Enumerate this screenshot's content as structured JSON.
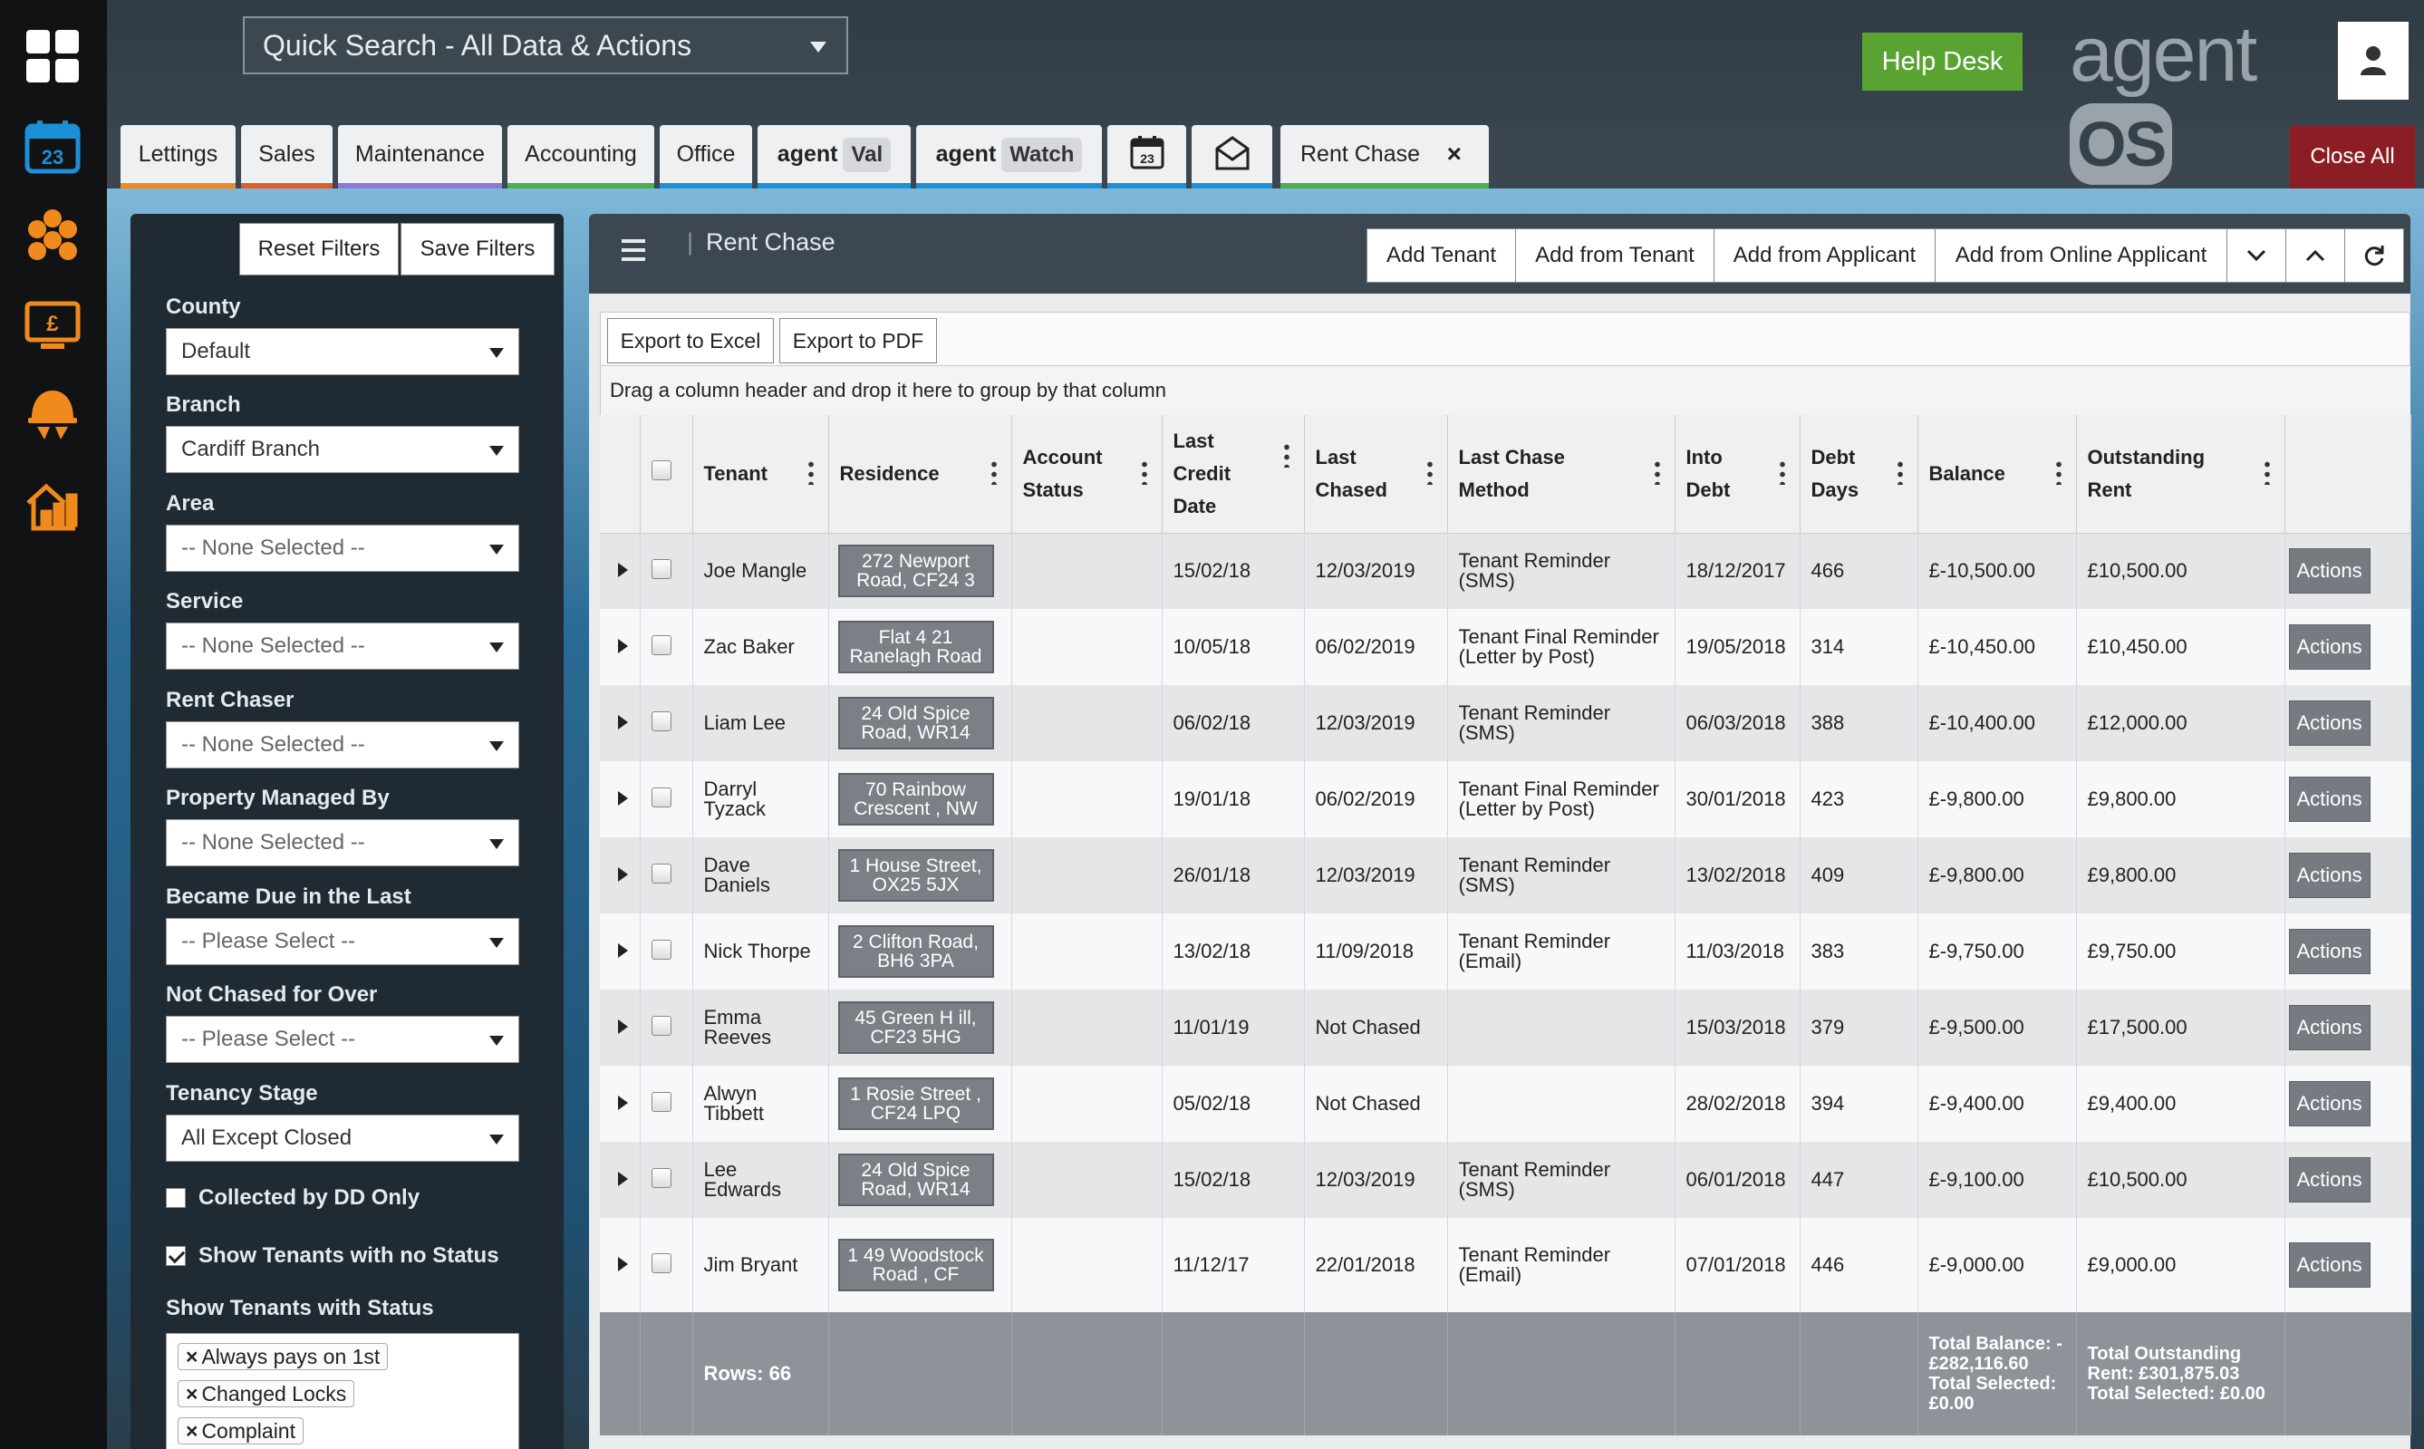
{
  "topbar": {
    "quick_search": "Quick Search - All Data & Actions",
    "help_desk": "Help Desk",
    "logo_agent": "agent",
    "logo_os": "OS"
  },
  "tabs": {
    "lettings": "Lettings",
    "sales": "Sales",
    "maintenance": "Maintenance",
    "accounting": "Accounting",
    "office": "Office",
    "agent_prefix": "agent",
    "val": "Val",
    "watch": "Watch",
    "calendar_day": "23",
    "rent_chase": "Rent Chase",
    "close_x": "×",
    "close_all": "Close All"
  },
  "rail": {
    "calendar_day": "23"
  },
  "filters": {
    "reset": "Reset Filters",
    "save": "Save Filters",
    "county_label": "County",
    "county_value": "Default",
    "branch_label": "Branch",
    "branch_value": "Cardiff Branch",
    "area_label": "Area",
    "area_value": "-- None Selected --",
    "service_label": "Service",
    "service_value": "-- None Selected --",
    "rent_chaser_label": "Rent Chaser",
    "rent_chaser_value": "-- None Selected --",
    "managed_label": "Property Managed By",
    "managed_value": "-- None Selected --",
    "due_label": "Became Due in the Last",
    "due_value": "-- Please Select --",
    "not_chased_label": "Not Chased for Over",
    "not_chased_value": "-- Please Select --",
    "stage_label": "Tenancy Stage",
    "stage_value": "All Except Closed",
    "dd_only": "Collected by DD Only",
    "dd_only_checked": false,
    "no_status": "Show Tenants with no Status",
    "no_status_checked": true,
    "with_status_label": "Show Tenants with Status",
    "status_tags": [
      "Always pays on 1st",
      "Changed Locks",
      "Complaint"
    ],
    "tag_remove": "×"
  },
  "grid": {
    "title": "Rent Chase",
    "add_tenant": "Add Tenant",
    "add_from_tenant": "Add from Tenant",
    "add_from_applicant": "Add from Applicant",
    "add_from_online": "Add from Online Applicant",
    "export_excel": "Export to Excel",
    "export_pdf": "Export to PDF",
    "group_hint": "Drag a column header and drop it here to group by that column",
    "columns": {
      "tenant": "Tenant",
      "residence": "Residence",
      "account_status": "Account Status",
      "last_credit_date": "Last Credit Date",
      "last_chased": "Last Chased",
      "last_chase_method": "Last Chase Method",
      "into_debt": "Into Debt",
      "debt_days": "Debt Days",
      "balance": "Balance",
      "outstanding_rent": "Outstanding Rent"
    },
    "action_label": "Actions",
    "rows": [
      {
        "tenant": "Joe Mangle",
        "residence": "272 Newport Road, CF24 3",
        "status": "",
        "credit": "15/02/18",
        "chased": "12/03/2019",
        "method": "Tenant Reminder (SMS)",
        "debt": "18/12/2017",
        "days": "466",
        "balance": "£-10,500.00",
        "outstanding": "£10,500.00"
      },
      {
        "tenant": "Zac Baker",
        "residence": "Flat 4 21 Ranelagh Road",
        "status": "",
        "credit": "10/05/18",
        "chased": "06/02/2019",
        "method": "Tenant Final Reminder (Letter by Post)",
        "debt": "19/05/2018",
        "days": "314",
        "balance": "£-10,450.00",
        "outstanding": "£10,450.00"
      },
      {
        "tenant": "Liam Lee",
        "residence": "24 Old Spice Road, WR14",
        "status": "",
        "credit": "06/02/18",
        "chased": "12/03/2019",
        "method": "Tenant Reminder (SMS)",
        "debt": "06/03/2018",
        "days": "388",
        "balance": "£-10,400.00",
        "outstanding": "£12,000.00"
      },
      {
        "tenant": "Darryl Tyzack",
        "residence": "70 Rainbow Crescent , NW",
        "status": "",
        "credit": "19/01/18",
        "chased": "06/02/2019",
        "method": "Tenant Final Reminder (Letter by Post)",
        "debt": "30/01/2018",
        "days": "423",
        "balance": "£-9,800.00",
        "outstanding": "£9,800.00"
      },
      {
        "tenant": "Dave Daniels",
        "residence": "1 House Street, OX25 5JX",
        "status": "",
        "credit": "26/01/18",
        "chased": "12/03/2019",
        "method": "Tenant Reminder (SMS)",
        "debt": "13/02/2018",
        "days": "409",
        "balance": "£-9,800.00",
        "outstanding": "£9,800.00"
      },
      {
        "tenant": "Nick Thorpe",
        "residence": "2 Clifton Road, BH6 3PA",
        "status": "",
        "credit": "13/02/18",
        "chased": "11/09/2018",
        "method": "Tenant Reminder (Email)",
        "debt": "11/03/2018",
        "days": "383",
        "balance": "£-9,750.00",
        "outstanding": "£9,750.00"
      },
      {
        "tenant": "Emma Reeves",
        "residence": "45 Green H ill, CF23 5HG",
        "status": "",
        "credit": "11/01/19",
        "chased": "Not Chased",
        "method": "",
        "debt": "15/03/2018",
        "days": "379",
        "balance": "£-9,500.00",
        "outstanding": "£17,500.00"
      },
      {
        "tenant": "Alwyn Tibbett",
        "residence": "1 Rosie Street , CF24 LPQ",
        "status": "",
        "credit": "05/02/18",
        "chased": "Not Chased",
        "method": "",
        "debt": "28/02/2018",
        "days": "394",
        "balance": "£-9,400.00",
        "outstanding": "£9,400.00"
      },
      {
        "tenant": "Lee Edwards",
        "residence": "24 Old Spice Road, WR14",
        "status": "",
        "credit": "15/02/18",
        "chased": "12/03/2019",
        "method": "Tenant Reminder (SMS)",
        "debt": "06/01/2018",
        "days": "447",
        "balance": "£-9,100.00",
        "outstanding": "£10,500.00"
      },
      {
        "tenant": "Jim Bryant",
        "residence": "1 49 Woodstock Road , CF",
        "status": "",
        "credit": "11/12/17",
        "chased": "22/01/2018",
        "method": "Tenant Reminder (Email)",
        "debt": "07/01/2018",
        "days": "446",
        "balance": "£-9,000.00",
        "outstanding": "£9,000.00"
      }
    ],
    "footer": {
      "rows": "Rows: 66",
      "balance_total": "Total Balance: -£282,116.60 Total Selected: £0.00",
      "outstanding_total": "Total Outstanding Rent: £301,875.03 Total Selected: £0.00"
    }
  },
  "colors": {
    "help_green": "#5aa332",
    "close_red": "#8b1e24",
    "rail_orange": "#f08a1c",
    "rail_blue": "#1d8fd6"
  }
}
